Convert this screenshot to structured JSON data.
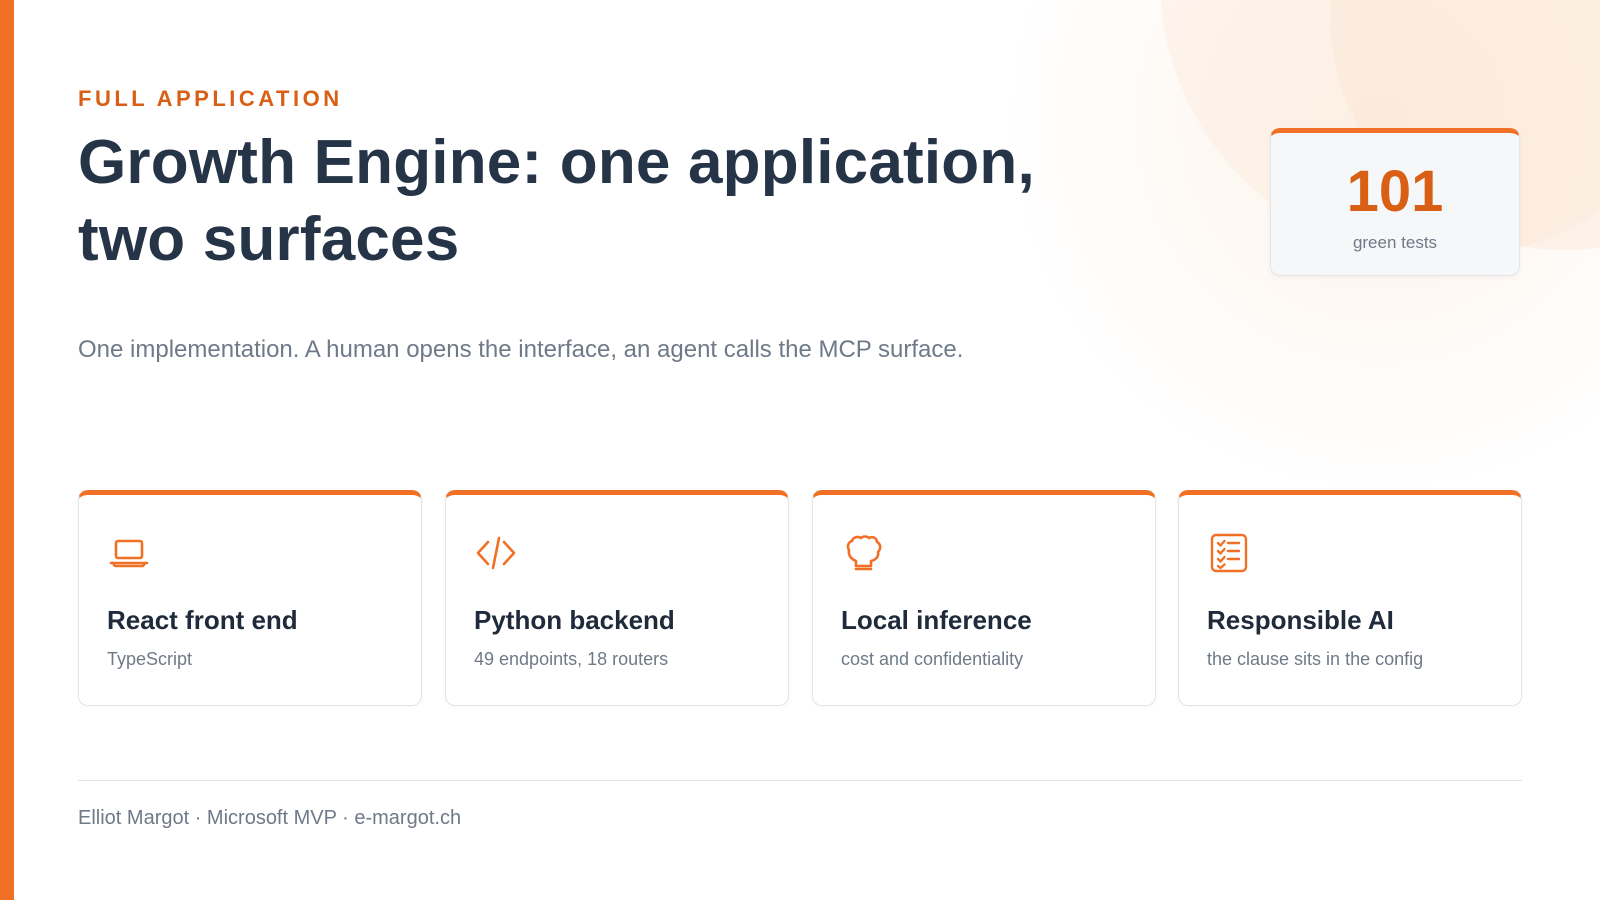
{
  "eyebrow": "FULL APPLICATION",
  "title": "Growth Engine: one application, two surfaces",
  "subtitle": "One implementation. A human opens the interface, an agent calls the MCP surface.",
  "stat": {
    "value": "101",
    "label": "green tests"
  },
  "cards": [
    {
      "icon": "laptop-icon",
      "title": "React front end",
      "subtitle": "TypeScript"
    },
    {
      "icon": "code-icon",
      "title": "Python backend",
      "subtitle": "49 endpoints, 18 routers"
    },
    {
      "icon": "brain-icon",
      "title": "Local inference",
      "subtitle": "cost and confidentiality"
    },
    {
      "icon": "checklist-icon",
      "title": "Responsible AI",
      "subtitle": "the clause sits in the config"
    }
  ],
  "footer": "Elliot Margot · Microsoft MVP · e-margot.ch",
  "colors": {
    "accent": "#f07125",
    "accent_text": "#d85f14",
    "title": "#263447",
    "muted": "#6f7a89"
  }
}
